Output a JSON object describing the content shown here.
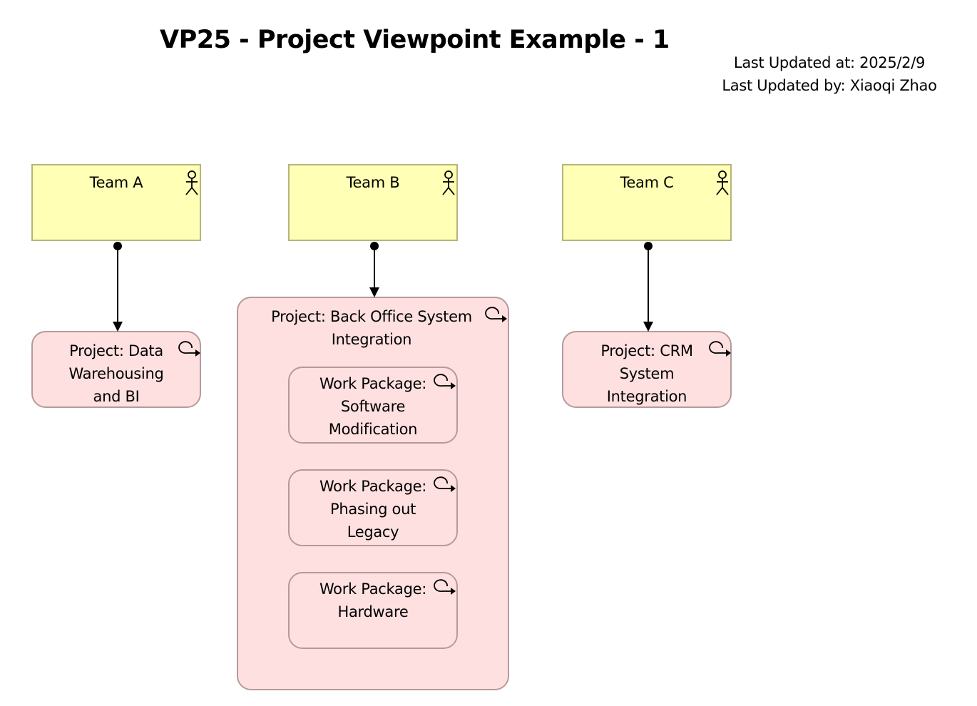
{
  "header": {
    "title": "VP25 - Project Viewpoint Example - 1",
    "last_updated_at": "Last Updated at: 2025/2/9",
    "last_updated_by": "Last Updated by: Xiaoqi Zhao"
  },
  "colors": {
    "actor_fill": "#ffffb5",
    "actor_border": "#b5b57a",
    "project_fill": "#ffe0e0",
    "project_border": "#b59a9a",
    "edge": "#000000"
  },
  "actors": [
    {
      "id": "team-a",
      "label": "Team A",
      "icon": "actor-icon"
    },
    {
      "id": "team-b",
      "label": "Team B",
      "icon": "actor-icon"
    },
    {
      "id": "team-c",
      "label": "Team C",
      "icon": "actor-icon"
    }
  ],
  "projects": [
    {
      "id": "project-data-warehousing",
      "label": "Project: Data\nWarehousing\nand BI",
      "icon": "work-package-icon"
    },
    {
      "id": "project-back-office",
      "label": "Project: Back Office System\nIntegration",
      "icon": "work-package-icon"
    },
    {
      "id": "project-crm",
      "label": "Project: CRM\nSystem\nIntegration",
      "icon": "work-package-icon"
    }
  ],
  "work_packages": [
    {
      "id": "wp-software-modification",
      "parent": "project-back-office",
      "label": "Work Package:\nSoftware\nModification",
      "icon": "work-package-icon"
    },
    {
      "id": "wp-phasing-out-legacy",
      "parent": "project-back-office",
      "label": "Work Package:\nPhasing out\nLegacy",
      "icon": "work-package-icon"
    },
    {
      "id": "wp-hardware",
      "parent": "project-back-office",
      "label": "Work Package:\nHardware",
      "icon": "work-package-icon"
    }
  ],
  "relationships": [
    {
      "type": "assignment",
      "from": "team-a",
      "to": "project-data-warehousing"
    },
    {
      "type": "assignment",
      "from": "team-b",
      "to": "project-back-office"
    },
    {
      "type": "assignment",
      "from": "team-c",
      "to": "project-crm"
    }
  ]
}
